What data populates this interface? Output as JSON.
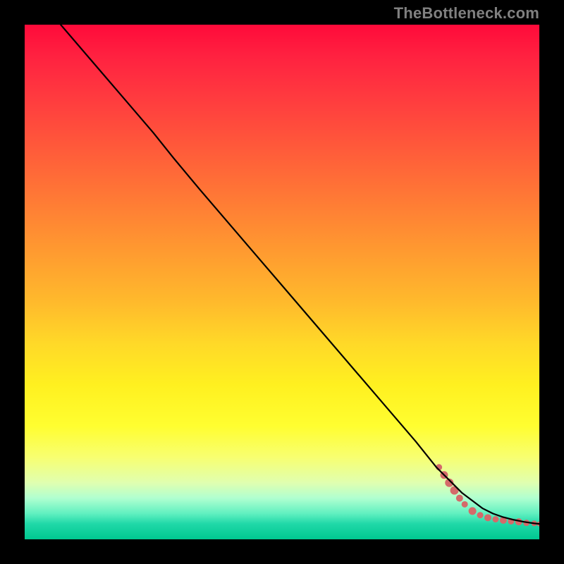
{
  "watermark": "TheBottleneck.com",
  "colors": {
    "scatter": "#d46a6a",
    "curve": "#000000"
  },
  "chart_data": {
    "type": "line",
    "title": "",
    "xlabel": "",
    "ylabel": "",
    "xlim": [
      0,
      100
    ],
    "ylim": [
      0,
      100
    ],
    "grid": false,
    "legend": false,
    "series": [
      {
        "name": "bottleneck-curve",
        "type": "line",
        "x": [
          7,
          13,
          19,
          25,
          29,
          34,
          40,
          46,
          52,
          58,
          64,
          70,
          76,
          80,
          83,
          85,
          87,
          89,
          91,
          93,
          95,
          97,
          99,
          100
        ],
        "y": [
          100,
          93,
          86,
          79,
          74,
          68,
          61,
          54,
          47,
          40,
          33,
          26,
          19,
          14,
          11,
          9,
          7.5,
          6,
          5,
          4.3,
          3.8,
          3.4,
          3.1,
          3.0
        ]
      },
      {
        "name": "optimal-zone-scatter",
        "type": "scatter",
        "points": [
          {
            "x": 80.5,
            "y": 14.0,
            "r": 4.5
          },
          {
            "x": 81.5,
            "y": 12.5,
            "r": 5.5
          },
          {
            "x": 82.5,
            "y": 11.0,
            "r": 6.0
          },
          {
            "x": 83.5,
            "y": 9.5,
            "r": 6.0
          },
          {
            "x": 84.5,
            "y": 8.0,
            "r": 5.0
          },
          {
            "x": 85.5,
            "y": 6.8,
            "r": 4.5
          },
          {
            "x": 87.0,
            "y": 5.5,
            "r": 5.5
          },
          {
            "x": 88.5,
            "y": 4.7,
            "r": 4.5
          },
          {
            "x": 90.0,
            "y": 4.2,
            "r": 5.0
          },
          {
            "x": 91.5,
            "y": 3.9,
            "r": 4.5
          },
          {
            "x": 93.0,
            "y": 3.7,
            "r": 5.0
          },
          {
            "x": 94.5,
            "y": 3.5,
            "r": 4.5
          },
          {
            "x": 96.0,
            "y": 3.4,
            "r": 5.0
          },
          {
            "x": 97.5,
            "y": 3.2,
            "r": 4.5
          },
          {
            "x": 99.0,
            "y": 3.1,
            "r": 4.0
          },
          {
            "x": 100.0,
            "y": 3.0,
            "r": 3.5
          }
        ]
      }
    ]
  }
}
